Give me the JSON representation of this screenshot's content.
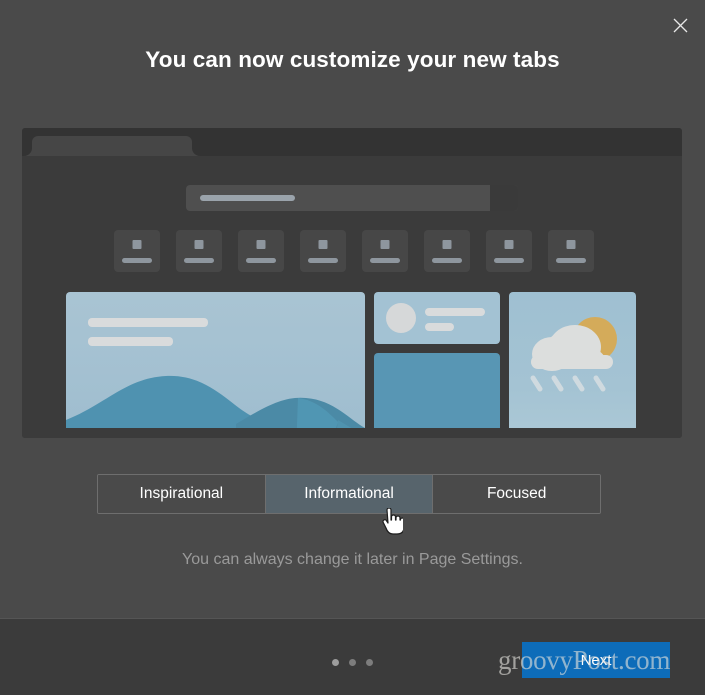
{
  "dialog": {
    "title": "You can now customize your new tabs",
    "helper_text": "You can always change it later in Page Settings.",
    "close_icon": "close-icon",
    "background_color": "#4a4a4a"
  },
  "preview": {
    "background_color": "#3b3b3b",
    "tab": {
      "label": ""
    },
    "searchbar": {
      "placeholder": ""
    },
    "shortcut_tiles": [
      {
        "label": ""
      },
      {
        "label": ""
      },
      {
        "label": ""
      },
      {
        "label": ""
      },
      {
        "label": ""
      },
      {
        "label": ""
      },
      {
        "label": ""
      },
      {
        "label": ""
      }
    ],
    "cards": {
      "hero": {
        "name": "hero-image-card"
      },
      "info": {
        "name": "info-card"
      },
      "block": {
        "name": "content-block-card"
      },
      "weather": {
        "name": "weather-card",
        "icon": "cloud-sun-rain-icon"
      }
    }
  },
  "layout_options": {
    "selected": "Informational",
    "options": [
      {
        "label": "Inspirational",
        "selected": false
      },
      {
        "label": "Informational",
        "selected": true
      },
      {
        "label": "Focused",
        "selected": false
      }
    ]
  },
  "footer": {
    "dots": [
      {
        "active": true
      },
      {
        "active": false
      },
      {
        "active": false
      }
    ],
    "next_label": "Next",
    "next_color": "#0d6cb9"
  },
  "watermark": {
    "text": "groovyPost.com"
  }
}
